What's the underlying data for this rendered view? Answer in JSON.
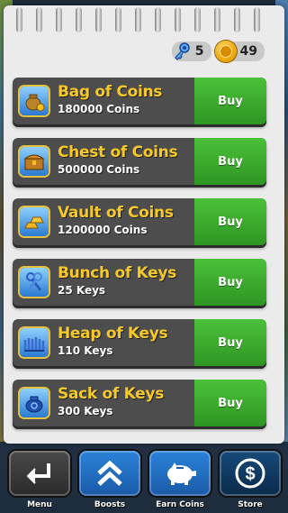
{
  "counters": {
    "keys": "5",
    "coins": "49"
  },
  "offers": [
    {
      "title": "Bag of Coins",
      "amount": "180000 Coins",
      "buy_label": "Buy",
      "icon": "coin-bag-icon"
    },
    {
      "title": "Chest of Coins",
      "amount": "500000 Coins",
      "buy_label": "Buy",
      "icon": "treasure-chest-icon"
    },
    {
      "title": "Vault of Coins",
      "amount": "1200000 Coins",
      "buy_label": "Buy",
      "icon": "gold-bars-icon"
    },
    {
      "title": "Bunch of Keys",
      "amount": "25 Keys",
      "buy_label": "Buy",
      "icon": "keys-bunch-icon"
    },
    {
      "title": "Heap of Keys",
      "amount": "110 Keys",
      "buy_label": "Buy",
      "icon": "keys-heap-icon"
    },
    {
      "title": "Sack of Keys",
      "amount": "300 Keys",
      "buy_label": "Buy",
      "icon": "key-sack-icon"
    }
  ],
  "nav": [
    {
      "label": "Menu",
      "icon": "back-arrow-icon"
    },
    {
      "label": "Boosts",
      "icon": "chevrons-up-icon"
    },
    {
      "label": "Earn Coins",
      "icon": "piggy-bank-icon"
    },
    {
      "label": "Store",
      "icon": "dollar-icon"
    }
  ],
  "colors": {
    "title_yellow": "#f7c928",
    "buy_green": "#3aa82c",
    "card_gray": "#4d4d4d",
    "nav_dark": "#3a3a3a",
    "nav_blue": "#1f6bb8",
    "nav_navy": "#103456"
  }
}
